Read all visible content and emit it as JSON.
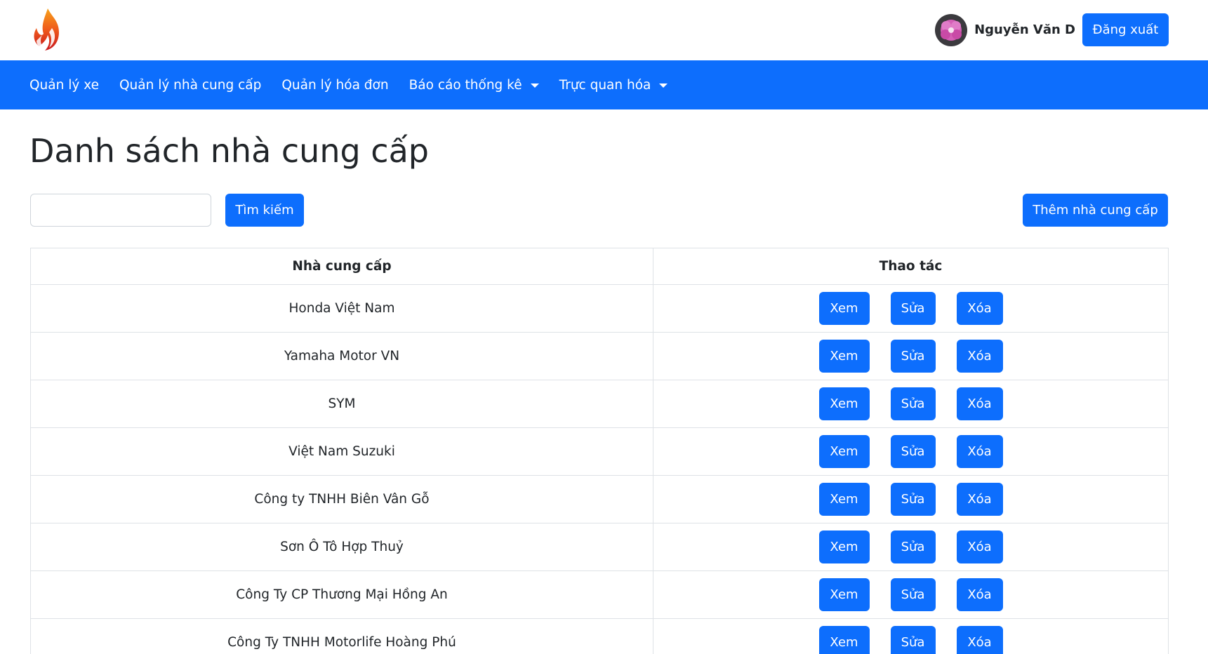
{
  "header": {
    "logo_icon": "flame-logo-icon",
    "user_name": "Nguyễn Văn D",
    "logout_label": "Đăng xuất"
  },
  "nav": {
    "items": [
      {
        "label": "Quản lý xe",
        "dropdown": false
      },
      {
        "label": "Quản lý nhà cung cấp",
        "dropdown": false
      },
      {
        "label": "Quản lý hóa đơn",
        "dropdown": false
      },
      {
        "label": "Báo cáo thống kê",
        "dropdown": true
      },
      {
        "label": "Trực quan hóa",
        "dropdown": true
      }
    ]
  },
  "page": {
    "title": "Danh sách nhà cung cấp",
    "search_value": "",
    "search_button": "Tìm kiếm",
    "add_button": "Thêm nhà cung cấp"
  },
  "table": {
    "headers": [
      "Nhà cung cấp",
      "Thao tác"
    ],
    "rows": [
      "Honda Việt Nam",
      "Yamaha Motor VN",
      "SYM",
      "Việt Nam Suzuki",
      "Công ty TNHH Biên Vân Gỗ",
      "Sơn Ô Tô Hợp Thuỷ",
      "Công Ty CP Thương Mại Hồng An",
      "Công Ty TNHH Motorlife Hoàng Phú"
    ],
    "actions": {
      "view": "Xem",
      "edit": "Sửa",
      "delete": "Xóa"
    }
  },
  "colors": {
    "primary": "#0d6efd",
    "text": "#212529",
    "border": "#dee2e6"
  }
}
